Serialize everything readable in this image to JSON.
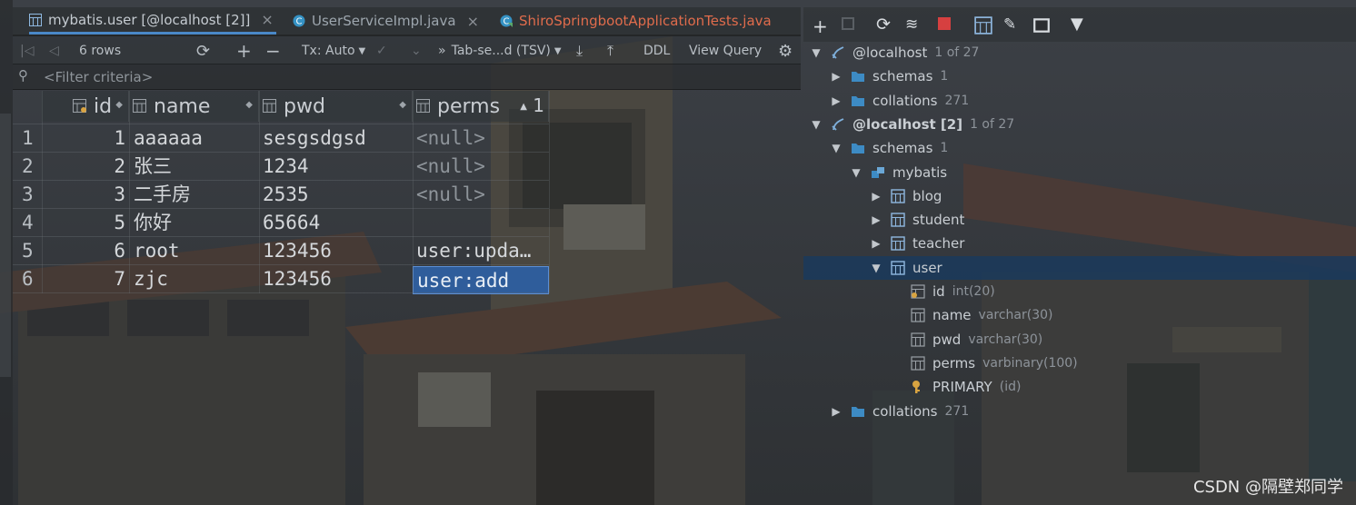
{
  "tabs": [
    {
      "label": "mybatis.user [@localhost [2]]",
      "active": true
    },
    {
      "label": "UserServiceImpl.java",
      "active": false
    },
    {
      "label": "ShiroSpringbootApplicationTests.java",
      "active": false
    }
  ],
  "toolbar": {
    "rows": "6 rows",
    "tx": "Tx: Auto",
    "format": "Tab-se...d (TSV)",
    "ddl": "DDL",
    "view_query": "View Query"
  },
  "filter": {
    "placeholder": "<Filter criteria>"
  },
  "grid": {
    "columns": [
      "id",
      "name",
      "pwd",
      "perms"
    ],
    "perms_sort_label": "1",
    "rows": [
      {
        "n": "1",
        "id": "1",
        "name": "aaaaaa",
        "pwd": "sesgsdgsd",
        "perms": "<null>"
      },
      {
        "n": "2",
        "id": "2",
        "name": "张三",
        "pwd": "1234",
        "perms": "<null>"
      },
      {
        "n": "3",
        "id": "3",
        "name": "二手房",
        "pwd": "2535",
        "perms": "<null>"
      },
      {
        "n": "4",
        "id": "5",
        "name": "你好",
        "pwd": "65664",
        "perms": ""
      },
      {
        "n": "5",
        "id": "6",
        "name": "root",
        "pwd": "123456",
        "perms": "user:upda…"
      },
      {
        "n": "6",
        "id": "7",
        "name": "zjc",
        "pwd": "123456",
        "perms": "user:add"
      }
    ]
  },
  "tree": [
    {
      "label": "@localhost",
      "extra": "1 of 27",
      "icon": "connection-icon",
      "arrow": "▼",
      "indent": 0,
      "bold": false
    },
    {
      "label": "schemas",
      "extra": "1",
      "icon": "folder-icon",
      "arrow": "▶",
      "indent": 1,
      "bold": false
    },
    {
      "label": "collations",
      "extra": "271",
      "icon": "folder-icon",
      "arrow": "▶",
      "indent": 1,
      "bold": false
    },
    {
      "label": "@localhost [2]",
      "extra": "1 of 27",
      "icon": "connection-icon",
      "arrow": "▼",
      "indent": 0,
      "bold": true
    },
    {
      "label": "schemas",
      "extra": "1",
      "icon": "folder-icon",
      "arrow": "▼",
      "indent": 1,
      "bold": false
    },
    {
      "label": "mybatis",
      "extra": "",
      "icon": "schema-icon",
      "arrow": "▼",
      "indent": 2,
      "bold": false
    },
    {
      "label": "blog",
      "extra": "",
      "icon": "table-icon",
      "arrow": "▶",
      "indent": 3,
      "bold": false
    },
    {
      "label": "student",
      "extra": "",
      "icon": "table-icon",
      "arrow": "▶",
      "indent": 3,
      "bold": false
    },
    {
      "label": "teacher",
      "extra": "",
      "icon": "table-icon",
      "arrow": "▶",
      "indent": 3,
      "bold": false
    },
    {
      "label": "user",
      "extra": "",
      "icon": "table-icon",
      "arrow": "▼",
      "indent": 3,
      "bold": false,
      "selected": true
    },
    {
      "label": "id",
      "extra": "int(20)",
      "icon": "key-column-icon",
      "arrow": "",
      "indent": 4,
      "bold": false
    },
    {
      "label": "name",
      "extra": "varchar(30)",
      "icon": "column-icon",
      "arrow": "",
      "indent": 4,
      "bold": false
    },
    {
      "label": "pwd",
      "extra": "varchar(30)",
      "icon": "column-icon",
      "arrow": "",
      "indent": 4,
      "bold": false
    },
    {
      "label": "perms",
      "extra": "varbinary(100)",
      "icon": "column-icon",
      "arrow": "",
      "indent": 4,
      "bold": false
    },
    {
      "label": "PRIMARY",
      "extra": "(id)",
      "icon": "key-icon",
      "arrow": "",
      "indent": 4,
      "bold": false
    },
    {
      "label": "collations",
      "extra": "271",
      "icon": "folder-icon",
      "arrow": "▶",
      "indent": 1,
      "bold": false
    }
  ],
  "watermark": "CSDN @隔壁郑同学",
  "colors": {
    "selection": "#2f5d9b",
    "tree_selection": "#1a3a5c",
    "accent": "#4a88c7"
  }
}
